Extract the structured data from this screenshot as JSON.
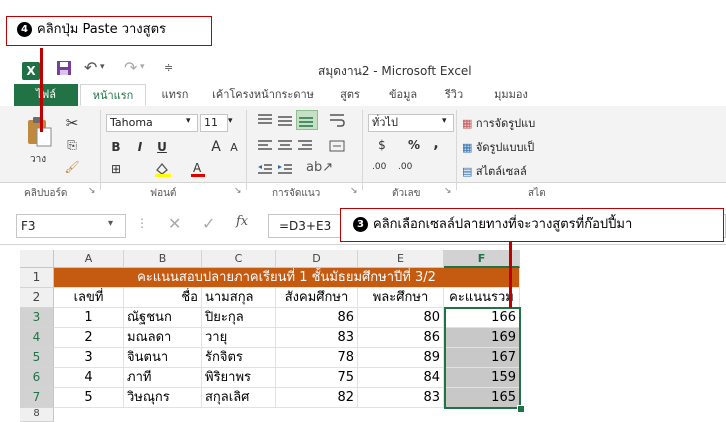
{
  "window_title": "สมุดงาน2 - Microsoft Excel",
  "app_logo": "X",
  "tabs": [
    "ไฟล์",
    "หน้าแรก",
    "แทรก",
    "เค้าโครงหน้ากระดาษ",
    "สูตร",
    "ข้อมูล",
    "รีวิว",
    "มุมมอง"
  ],
  "ribbon": {
    "paste_label": "วาง",
    "font_name": "Tahoma",
    "font_size": "11",
    "number_format": "ทั่วไป",
    "bold": "B",
    "italic": "I",
    "underline": "U",
    "grow_font": "A",
    "shrink_font": "A",
    "currency": "$",
    "percent": "%",
    "comma": ",",
    "inc_decimal": ".00",
    "dec_decimal": ".00",
    "styles": [
      "การจัดรูปแบ",
      "จัดรูปแบบเป็",
      "สไตล์เซลล์"
    ],
    "groups": [
      "คลิปบอร์ด",
      "ฟอนต์",
      "การจัดแนว",
      "ตัวเลข",
      "สไต"
    ]
  },
  "formula_bar": {
    "name_box": "F3",
    "fx": "fx",
    "formula": "=D3+E3"
  },
  "callouts": {
    "step4_num": "4",
    "step4_text": "คลิกปุ่ม Paste วางสูตร",
    "step3_num": "3",
    "step3_text": "คลิกเลือกเซลล์ปลายทางที่จะวางสูตรที่ก๊อปปี้มา"
  },
  "sheet": {
    "columns": [
      "A",
      "B",
      "C",
      "D",
      "E",
      "F"
    ],
    "rows": [
      "1",
      "2",
      "3",
      "4",
      "5",
      "6",
      "7",
      "8"
    ],
    "banner": "คะแนนสอบปลายภาคเรียนที่ 1 ชั้นมัธยมศึกษาปีที่ 3/2",
    "headers": [
      "เลขที่",
      "ชื่อ",
      "นามสกุล",
      "สังคมศึกษา",
      "พละศึกษา",
      "คะแนนรวม"
    ],
    "data": [
      [
        "1",
        "ณัฐชนก",
        "ปิยะกุล",
        "86",
        "80",
        "166"
      ],
      [
        "2",
        "มณลดา",
        "วายุ",
        "83",
        "86",
        "169"
      ],
      [
        "3",
        "จินตนา",
        "รักจิตร",
        "78",
        "89",
        "167"
      ],
      [
        "4",
        "ภาที",
        "พิริยาพร",
        "75",
        "84",
        "159"
      ],
      [
        "5",
        "วิษณุกร",
        "สกุลเลิศ",
        "82",
        "83",
        "165"
      ]
    ]
  },
  "colors": {
    "excel_green": "#217346",
    "banner": "#c55a11",
    "callout_border": "#c00000",
    "selection": "#c8c8c8"
  }
}
